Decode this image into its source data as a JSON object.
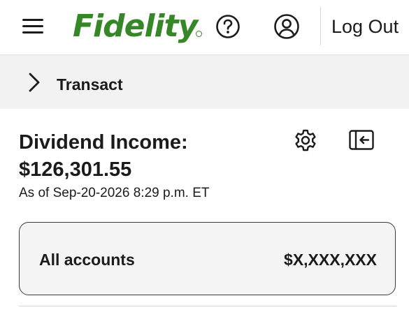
{
  "header": {
    "logo_text": "Fidelity",
    "brand_color": "#368727",
    "icons": [
      "menu-icon",
      "help-icon",
      "profile-icon"
    ],
    "logout_label": "Log Out"
  },
  "transact": {
    "label": "Transact",
    "icon": "chevron-right-icon"
  },
  "income": {
    "title": "Dividend Income:",
    "amount": "$126,301.55",
    "as_of": "As of Sep-20-2026 8:29 p.m. ET",
    "icons": [
      "gear-icon",
      "collapse-panel-icon"
    ]
  },
  "accounts": {
    "label": "All accounts",
    "value": "$X,XXX,XXX"
  }
}
